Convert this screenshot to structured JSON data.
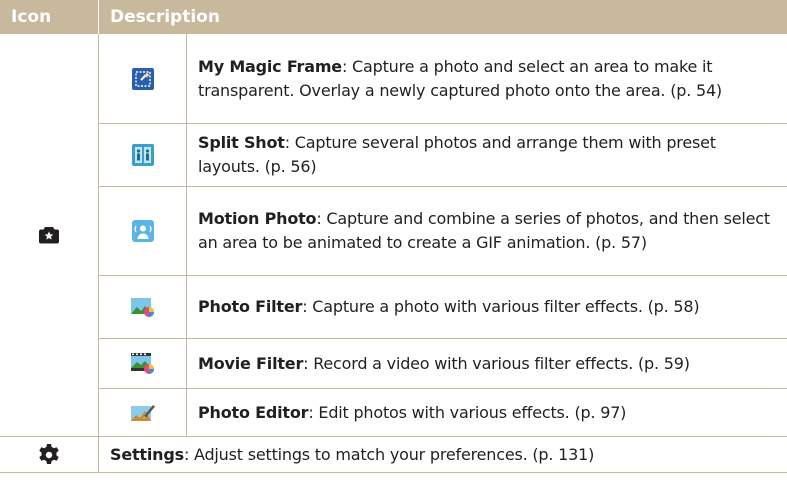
{
  "header": {
    "icon_col": "Icon",
    "desc_col": "Description"
  },
  "camera_group": {
    "icon": "camera-star-icon",
    "rows": [
      {
        "icon": "magic-frame-icon",
        "title": "My Magic Frame",
        "text": ": Capture a photo and select an area to make it transparent. Overlay a newly captured photo onto the area. (p. 54)"
      },
      {
        "icon": "split-shot-icon",
        "title": "Split Shot",
        "text": ": Capture several photos and arrange them with preset layouts. (p. 56)"
      },
      {
        "icon": "motion-photo-icon",
        "title": "Motion Photo",
        "text": ": Capture and combine a series of photos, and then select an area to be animated to create a GIF animation. (p. 57)"
      },
      {
        "icon": "photo-filter-icon",
        "title": "Photo Filter",
        "text": ": Capture a photo with various filter effects. (p. 58)"
      },
      {
        "icon": "movie-filter-icon",
        "title": "Movie Filter",
        "text": ": Record a video with various filter effects. (p. 59)"
      },
      {
        "icon": "photo-editor-icon",
        "title": "Photo Editor",
        "text": ": Edit photos with various effects. (p. 97)"
      }
    ]
  },
  "settings_row": {
    "icon": "gear-icon",
    "title": "Settings",
    "text": ": Adjust settings to match your preferences. (p. 131)"
  },
  "colors": {
    "header_bg": "#c8b89c",
    "border": "#c8b89c",
    "text": "#231f20"
  }
}
